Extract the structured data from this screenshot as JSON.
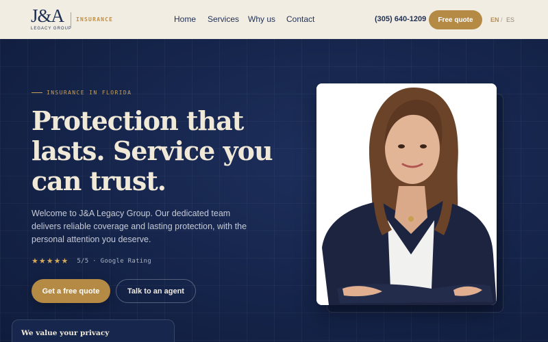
{
  "brand": {
    "logo_mark": "J&A",
    "logo_sub": "LEGACY GROUP",
    "tagline": "INSURANCE"
  },
  "nav": {
    "items": [
      {
        "label": "Home"
      },
      {
        "label": "Services"
      },
      {
        "label": "Why us"
      },
      {
        "label": "Contact"
      }
    ],
    "phone": "(305) 640-1209",
    "cta": "Free quote",
    "lang_en": "EN",
    "lang_sep": "/",
    "lang_es": "ES",
    "active_lang": "EN"
  },
  "hero": {
    "eyebrow": "INSURANCE IN FLORIDA",
    "headline_lines": [
      "Protection that",
      "lasts. Service you",
      "can trust."
    ],
    "subtext": "Welcome to J&A Legacy Group. Our dedicated team delivers reliable coverage and lasting protection, with the personal attention you deserve.",
    "stars": "★★★★★",
    "rating_text": "5/5 · Google Rating",
    "rating_value": 5,
    "primary_cta": "Get a free quote",
    "secondary_cta": "Talk to an agent"
  },
  "privacy": {
    "title": "We value your privacy"
  },
  "colors": {
    "navy": "#14234a",
    "gold": "#b48a45",
    "cream": "#f2ede3",
    "headline": "#f1e9d8"
  }
}
